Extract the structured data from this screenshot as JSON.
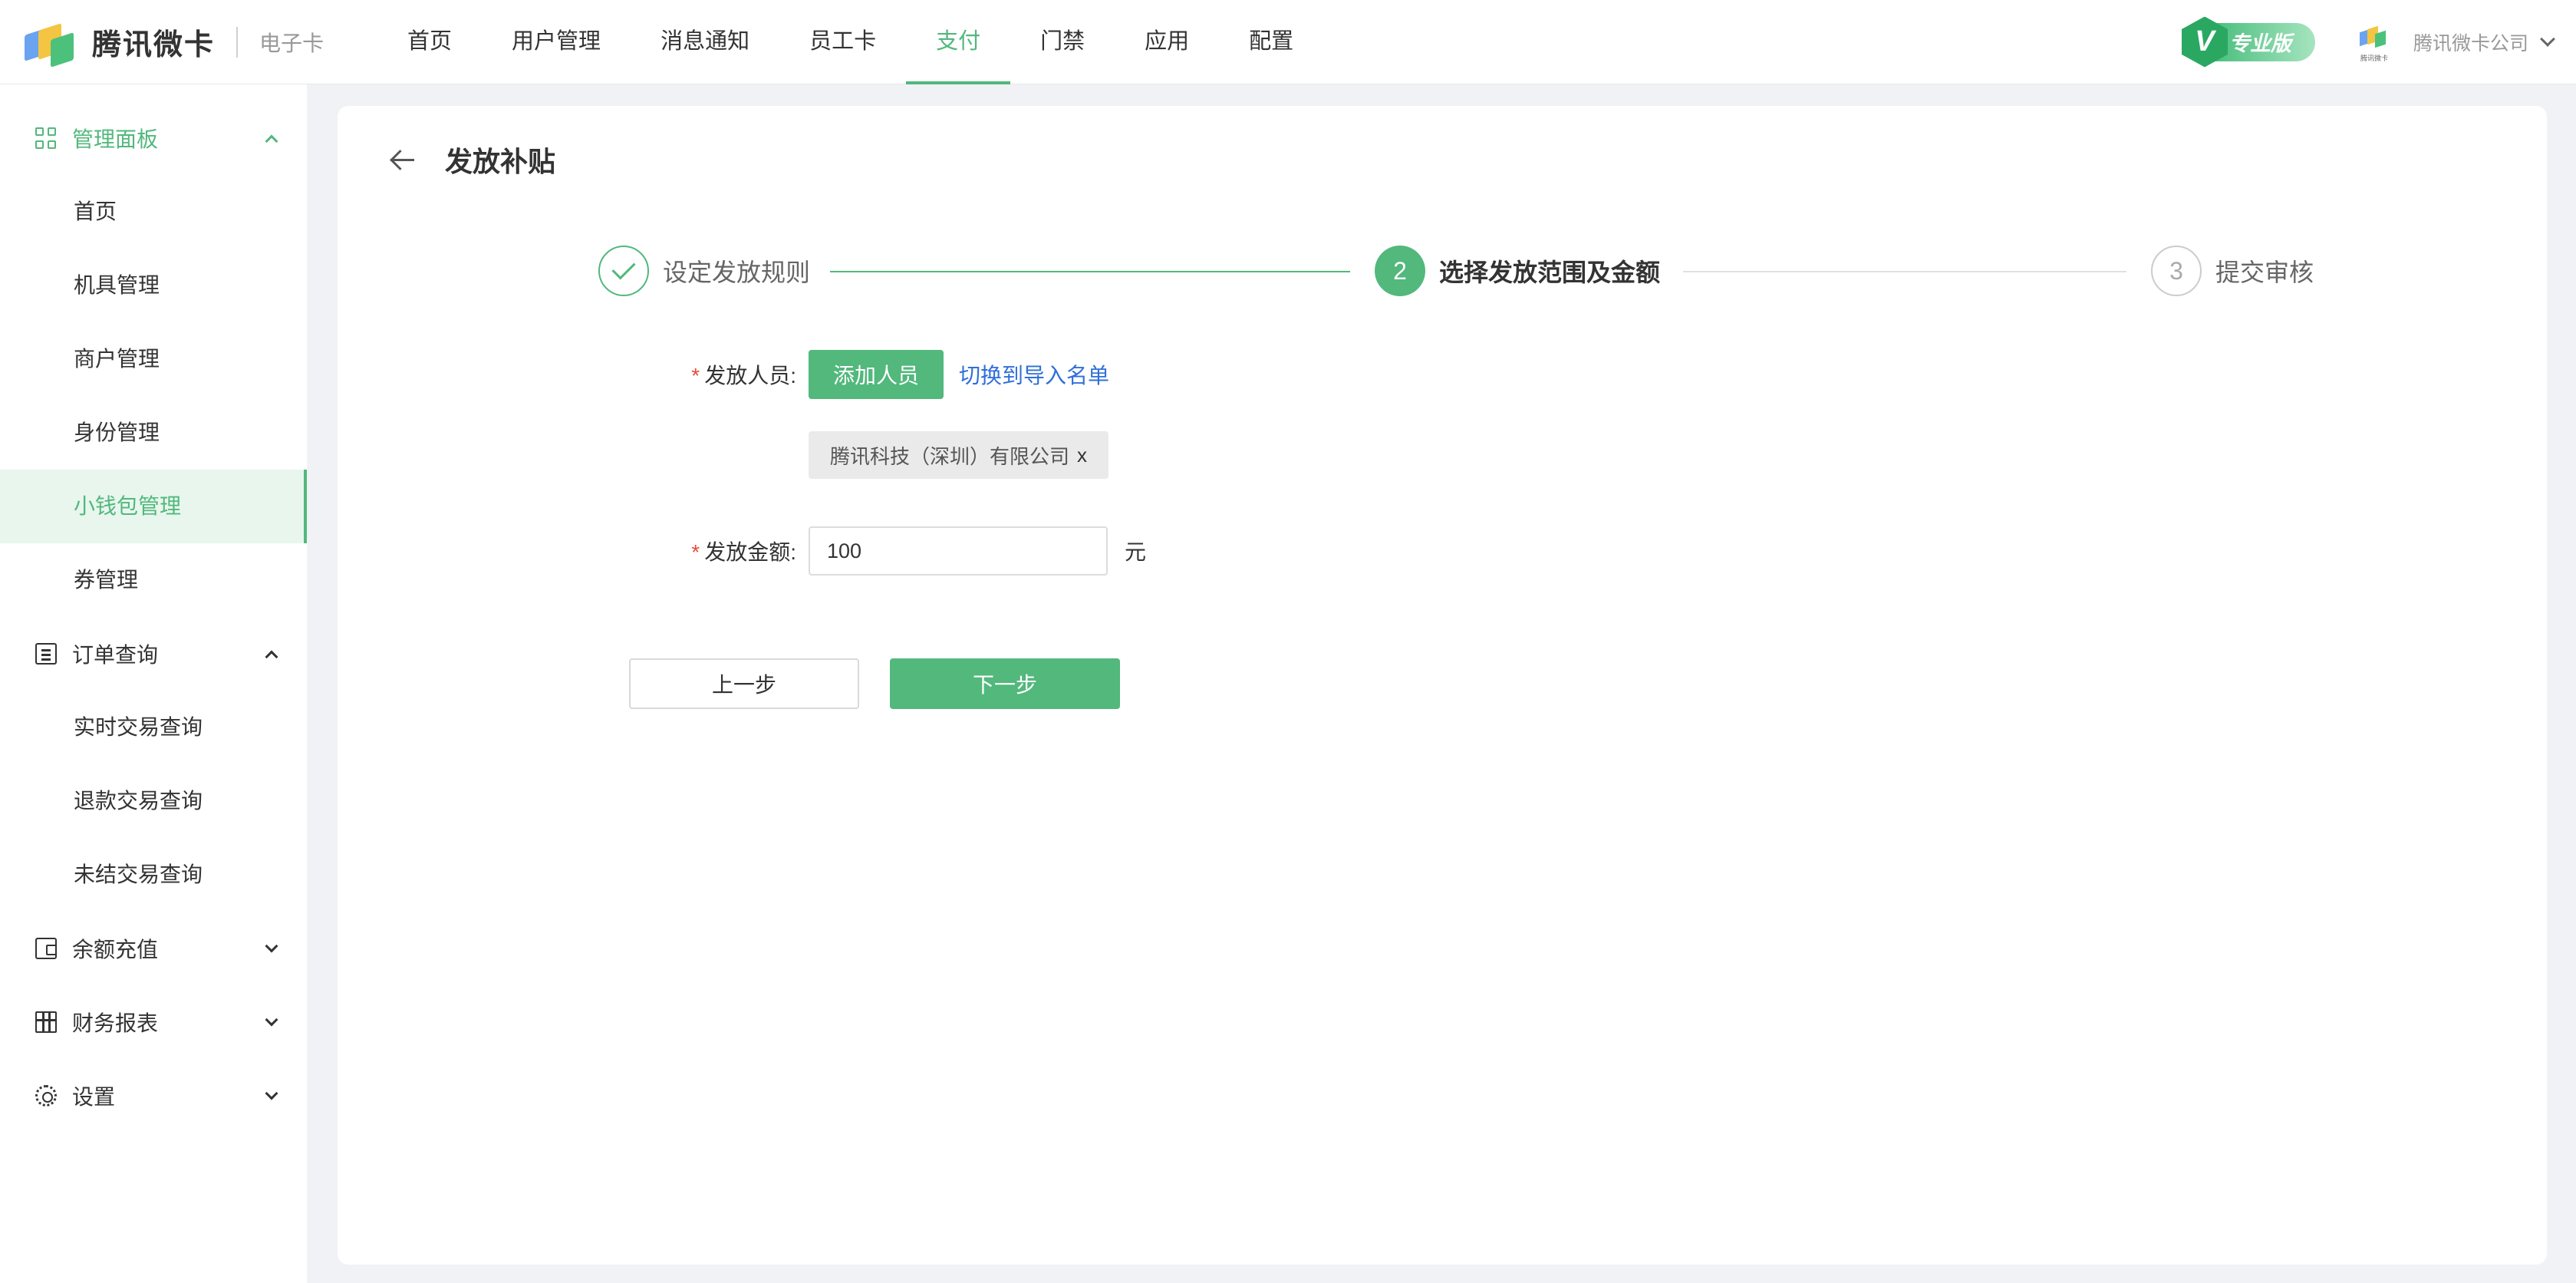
{
  "brand": {
    "name": "腾讯微卡",
    "sub": "电子卡"
  },
  "topnav": {
    "items": [
      "首页",
      "用户管理",
      "消息通知",
      "员工卡",
      "支付",
      "门禁",
      "应用",
      "配置"
    ],
    "active": "支付"
  },
  "account": {
    "badge_letter": "V",
    "badge_text": "专业版",
    "company_logo_caption": "腾讯微卡",
    "company": "腾讯微卡公司"
  },
  "sidebar": {
    "group_dashboard": "管理面板",
    "dashboard_items": [
      "首页",
      "机具管理",
      "商户管理",
      "身份管理",
      "小钱包管理",
      "券管理"
    ],
    "active_item": "小钱包管理",
    "group_orders": "订单查询",
    "order_items": [
      "实时交易查询",
      "退款交易查询",
      "未结交易查询"
    ],
    "group_recharge": "余额充值",
    "group_reports": "财务报表",
    "group_settings": "设置"
  },
  "page": {
    "title": "发放补贴"
  },
  "steps": [
    {
      "number": "1",
      "label": "设定发放规则",
      "state": "done"
    },
    {
      "number": "2",
      "label": "选择发放范围及金额",
      "state": "current"
    },
    {
      "number": "3",
      "label": "提交审核",
      "state": "pending"
    }
  ],
  "form": {
    "recipients_label": "发放人员",
    "add_button": "添加人员",
    "switch_link": "切换到导入名单",
    "selected_tag": "腾讯科技（深圳）有限公司",
    "tag_close": "x",
    "amount_label": "发放金额",
    "amount_value": "100",
    "amount_unit": "元",
    "required_mark": "*",
    "colon": ":"
  },
  "actions": {
    "prev": "上一步",
    "next": "下一步"
  },
  "colors": {
    "accent": "#52b87c",
    "link": "#2f6fd9",
    "required": "#e64b3c"
  }
}
